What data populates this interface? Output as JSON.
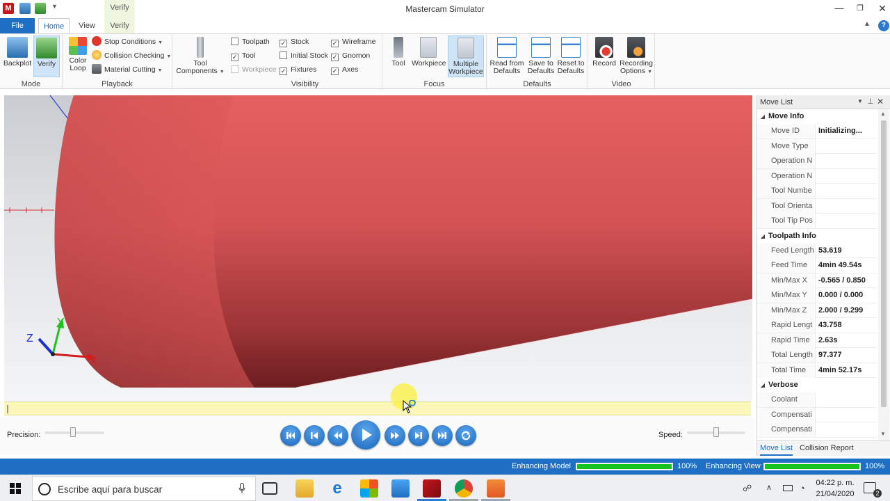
{
  "window": {
    "title": "Mastercam Simulator",
    "app_badge": "M"
  },
  "tabs": {
    "contextual": "Verify",
    "file": "File",
    "home": "Home",
    "view": "View",
    "verify": "Verify"
  },
  "ribbon": {
    "mode": {
      "label": "Mode",
      "backplot": "Backplot",
      "verify": "Verify"
    },
    "playback": {
      "label": "Playback",
      "color_loop_1": "Color",
      "color_loop_2": "Loop",
      "stop_conditions": "Stop Conditions",
      "collision_checking": "Collision Checking",
      "material_cutting": "Material Cutting"
    },
    "tool_components": {
      "line1": "Tool",
      "line2": "Components"
    },
    "visibility": {
      "label": "Visibility",
      "items": [
        {
          "label": "Toolpath",
          "checked": false,
          "enabled": true
        },
        {
          "label": "Tool",
          "checked": true,
          "enabled": true
        },
        {
          "label": "Workpiece",
          "checked": false,
          "enabled": false
        },
        {
          "label": "Stock",
          "checked": true,
          "enabled": true
        },
        {
          "label": "Initial Stock",
          "checked": false,
          "enabled": true
        },
        {
          "label": "Fixtures",
          "checked": true,
          "enabled": true
        },
        {
          "label": "Wireframe",
          "checked": true,
          "enabled": true
        },
        {
          "label": "Gnomon",
          "checked": true,
          "enabled": true
        },
        {
          "label": "Axes",
          "checked": true,
          "enabled": true
        }
      ]
    },
    "focus": {
      "label": "Focus",
      "tool": "Tool",
      "workpiece": "Workpiece",
      "multiple_1": "Multiple",
      "multiple_2": "Workpiece"
    },
    "defaults": {
      "label": "Defaults",
      "read_1": "Read from",
      "read_2": "Defaults",
      "save_1": "Save to",
      "save_2": "Defaults",
      "reset_1": "Reset to",
      "reset_2": "Defaults"
    },
    "video": {
      "label": "Video",
      "record": "Record",
      "recording_1": "Recording",
      "recording_2": "Options"
    }
  },
  "viewport": {
    "gnomon": {
      "x": "X",
      "y": "Y",
      "z": "Z"
    },
    "colors": {
      "stock": "#e05a5a",
      "background": "#dfe1e4"
    }
  },
  "playbar": {
    "precision_label": "Precision:",
    "speed_label": "Speed:",
    "precision_level": 0.48,
    "speed_level": 0.5
  },
  "move_list": {
    "title": "Move List",
    "sections": [
      {
        "title": "Move Info",
        "rows": [
          {
            "name": "Move ID",
            "value": "Initializing..."
          },
          {
            "name": "Move Type",
            "value": ""
          },
          {
            "name": "Operation N",
            "value": ""
          },
          {
            "name": "Operation N",
            "value": ""
          },
          {
            "name": "Tool Numbe",
            "value": ""
          },
          {
            "name": "Tool Orienta",
            "value": ""
          },
          {
            "name": "Tool Tip Pos",
            "value": ""
          }
        ]
      },
      {
        "title": "Toolpath Info",
        "rows": [
          {
            "name": "Feed Length",
            "value": "53.619"
          },
          {
            "name": "Feed Time",
            "value": "4min 49.54s"
          },
          {
            "name": "Min/Max X",
            "value": "-0.565 / 0.850"
          },
          {
            "name": "Min/Max Y",
            "value": "0.000 / 0.000"
          },
          {
            "name": "Min/Max Z",
            "value": "2.000 / 9.299"
          },
          {
            "name": "Rapid Lengt",
            "value": "43.758"
          },
          {
            "name": "Rapid Time",
            "value": "2.63s"
          },
          {
            "name": "Total Length",
            "value": "97.377"
          },
          {
            "name": "Total Time",
            "value": "4min 52.17s"
          }
        ]
      },
      {
        "title": "Verbose",
        "rows": [
          {
            "name": "Coolant",
            "value": ""
          },
          {
            "name": "Compensati",
            "value": ""
          },
          {
            "name": "Compensati",
            "value": ""
          }
        ]
      }
    ],
    "tabs": {
      "move_list": "Move List",
      "collision_report": "Collision Report"
    }
  },
  "status": {
    "model_label": "Enhancing Model",
    "model_progress": 100,
    "model_pct": "100%",
    "view_label": "Enhancing View",
    "view_progress": 100,
    "view_pct": "100%",
    "colors": {
      "bar_bg": "#1f6fc5",
      "progress": "#18c21e"
    }
  },
  "taskbar": {
    "search_placeholder": "Escribe aquí para buscar",
    "time": "04:22 p. m.",
    "date": "21/04/2020",
    "notifications": "2"
  }
}
